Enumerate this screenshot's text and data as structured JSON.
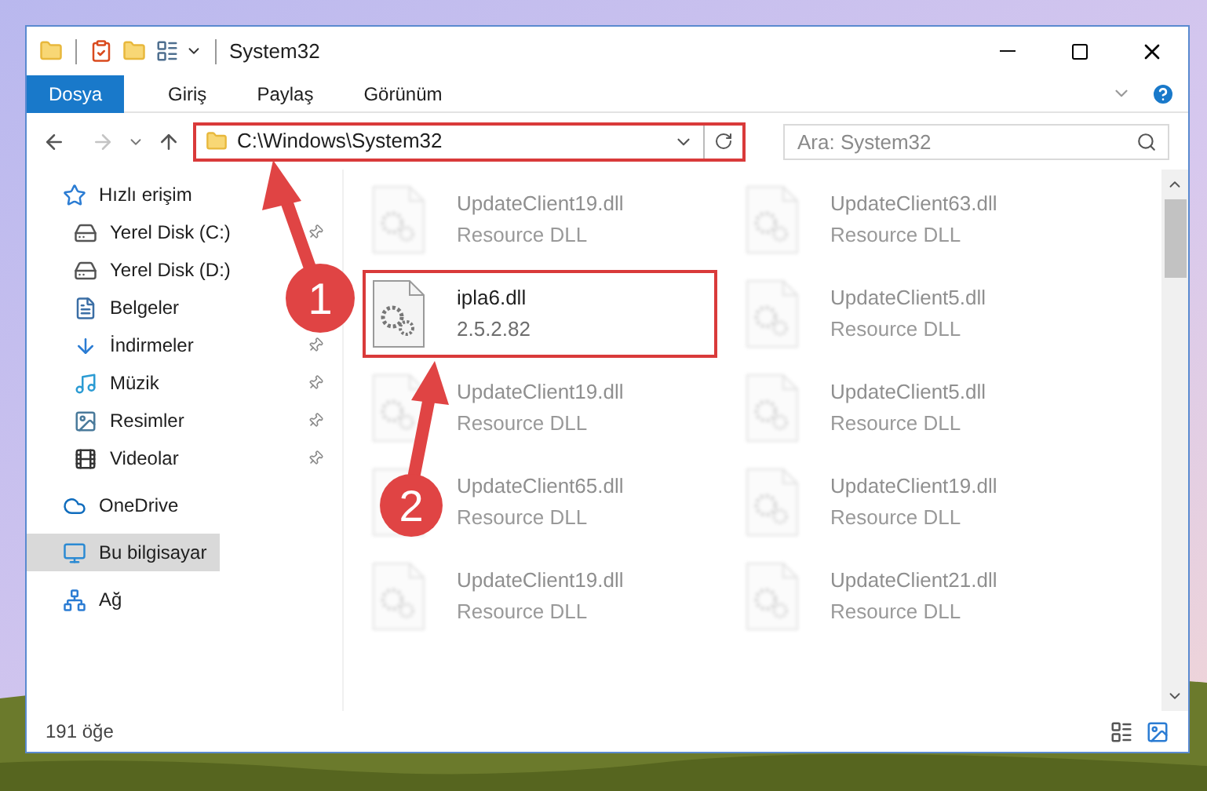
{
  "window": {
    "title": "System32"
  },
  "ribbon_tabs": [
    {
      "label": "Dosya",
      "selected": true
    },
    {
      "label": "Giriş",
      "selected": false
    },
    {
      "label": "Paylaş",
      "selected": false
    },
    {
      "label": "Görünüm",
      "selected": false
    }
  ],
  "address": {
    "path": "C:\\Windows\\System32",
    "highlighted": true
  },
  "search": {
    "placeholder": "Ara: System32"
  },
  "sidebar": {
    "items": [
      {
        "label": "Hızlı erişim",
        "kind": "quick",
        "selected": false,
        "children": [
          {
            "label": "Yerel Disk (C:)",
            "kind": "system-drive",
            "pinned": true,
            "selected": false
          },
          {
            "label": "Yerel Disk (D:)",
            "kind": "drive",
            "pinned": false,
            "selected": false
          },
          {
            "label": "Belgeler",
            "kind": "docs",
            "pinned": false,
            "selected": false
          },
          {
            "label": "İndirmeler",
            "kind": "downloads",
            "pinned": true,
            "selected": false
          },
          {
            "label": "Müzik",
            "kind": "music",
            "pinned": true,
            "selected": false
          },
          {
            "label": "Resimler",
            "kind": "pictures",
            "pinned": true,
            "selected": false
          },
          {
            "label": "Videolar",
            "kind": "videos",
            "pinned": true,
            "selected": false
          }
        ]
      },
      {
        "label": "OneDrive",
        "kind": "cloud",
        "selected": false
      },
      {
        "label": "Bu bilgisayar",
        "kind": "pc",
        "selected": true
      },
      {
        "label": "Ağ",
        "kind": "network",
        "selected": false
      }
    ]
  },
  "files": [
    {
      "name": "UpdateClient19.dll",
      "detail": "Resource DLL",
      "faded": true,
      "highlighted": false
    },
    {
      "name": "UpdateClient63.dll",
      "detail": "Resource DLL",
      "faded": true,
      "highlighted": false
    },
    {
      "name": "ipla6.dll",
      "detail": "2.5.2.82",
      "faded": false,
      "highlighted": true
    },
    {
      "name": "UpdateClient5.dll",
      "detail": "Resource DLL",
      "faded": true,
      "highlighted": false
    },
    {
      "name": "UpdateClient19.dll",
      "detail": "Resource DLL",
      "faded": true,
      "highlighted": false
    },
    {
      "name": "UpdateClient5.dll",
      "detail": "Resource DLL",
      "faded": true,
      "highlighted": false
    },
    {
      "name": "UpdateClient65.dll",
      "detail": "Resource DLL",
      "faded": true,
      "highlighted": false
    },
    {
      "name": "UpdateClient19.dll",
      "detail": "Resource DLL",
      "faded": true,
      "highlighted": false
    },
    {
      "name": "UpdateClient19.dll",
      "detail": "Resource DLL",
      "faded": true,
      "highlighted": false
    },
    {
      "name": "UpdateClient21.dll",
      "detail": "Resource DLL",
      "faded": true,
      "highlighted": false
    }
  ],
  "status_bar": {
    "count": "191 öğe"
  },
  "annotations": [
    {
      "label": "1"
    },
    {
      "label": "2"
    }
  ]
}
